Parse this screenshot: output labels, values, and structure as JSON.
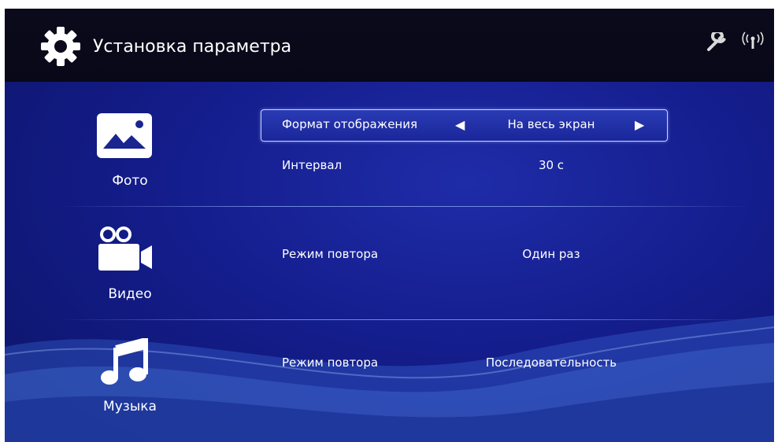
{
  "header": {
    "title": "Установка параметра",
    "icons": [
      "gear-icon",
      "wrench-icon",
      "wifi-icon"
    ]
  },
  "categories": [
    {
      "label": "Фото",
      "icon": "photo-icon"
    },
    {
      "label": "Видео",
      "icon": "video-camera-icon"
    },
    {
      "label": "Музыка",
      "icon": "music-note-icon"
    }
  ],
  "settings": {
    "photo": [
      {
        "label": "Формат отображения",
        "value": "На весь экран",
        "selected": true
      },
      {
        "label": "Интервал",
        "value": "30 с"
      }
    ],
    "video": [
      {
        "label": "Режим повтора",
        "value": "Один раз"
      }
    ],
    "music": [
      {
        "label": "Режим повтора",
        "value": "Последовательность"
      }
    ]
  },
  "colors": {
    "background": "#141d8c",
    "header": "#0b0a1c",
    "text": "#ffffff",
    "selection_border": "#c9d3ff"
  }
}
